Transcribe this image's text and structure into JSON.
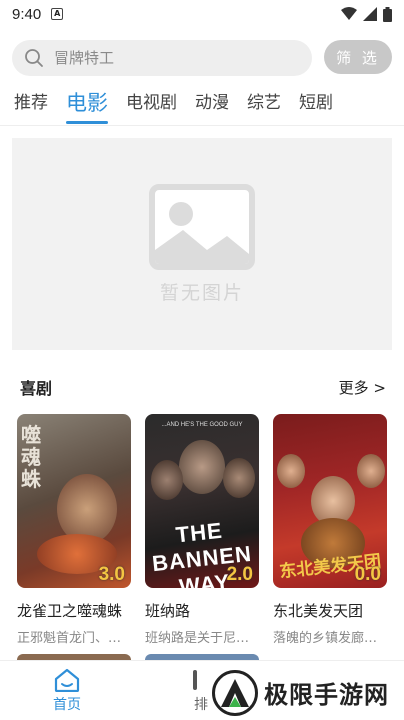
{
  "status_bar": {
    "time": "9:40",
    "notification_badge": "A"
  },
  "search": {
    "placeholder": "冒牌特工",
    "filter_label": "筛 选"
  },
  "tabs": [
    {
      "label": "推荐",
      "active": false
    },
    {
      "label": "电影",
      "active": true
    },
    {
      "label": "电视剧",
      "active": false
    },
    {
      "label": "动漫",
      "active": false
    },
    {
      "label": "综艺",
      "active": false
    },
    {
      "label": "短剧",
      "active": false
    }
  ],
  "banner": {
    "placeholder_text": "暂无图片"
  },
  "section": {
    "title": "喜剧",
    "more_label": "更多 >"
  },
  "cards": [
    {
      "title": "龙雀卫之噬魂蛛",
      "desc": "正邪魁首龙门、…",
      "rating": "3.0",
      "poster_text": "噬魂蛛"
    },
    {
      "title": "班纳路",
      "desc": "班纳路是关于尼…",
      "rating": "2.0",
      "poster_text": "THE BANNEN WAY",
      "poster_tagline": "...AND HE'S THE GOOD GUY"
    },
    {
      "title": "东北美发天团",
      "desc": "落魄的乡镇发廊…",
      "rating": "0.0",
      "poster_text": "东北美发天团"
    }
  ],
  "bottom_nav": [
    {
      "label": "首页",
      "icon": "home-icon",
      "active": true
    },
    {
      "label": "排",
      "icon": "ranking-icon",
      "active": false
    }
  ],
  "watermark": {
    "text": "极限手游网"
  },
  "colors": {
    "accent": "#2f8fd8",
    "rating": "#f4c542",
    "filter_bg": "#c8c8c8"
  }
}
